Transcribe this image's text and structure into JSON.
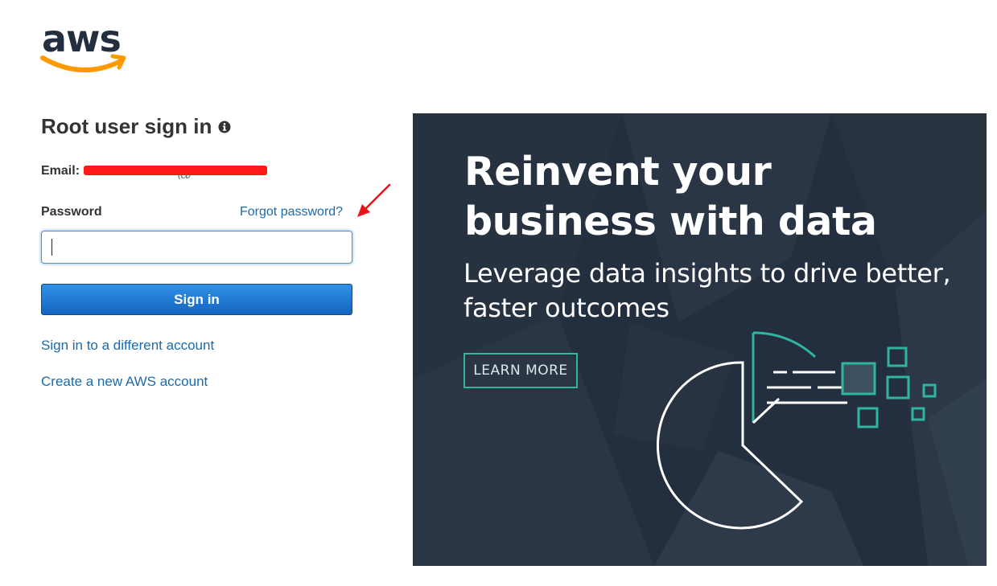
{
  "brand": {
    "logo_text": "aws",
    "logo_colors": {
      "text": "#232f3e",
      "smile": "#ff9900"
    }
  },
  "signin": {
    "title": "Root user sign in",
    "info_icon": "info-circle-icon",
    "email_label": "Email:",
    "email_visible_fragment": "@",
    "password_label": "Password",
    "forgot_link": "Forgot password?",
    "password_value": "",
    "submit_label": "Sign in",
    "links": {
      "different_account": "Sign in to a different account",
      "create_account": "Create a new AWS account"
    },
    "colors": {
      "link": "#1c6aa9",
      "button": "#1e78d6",
      "annotation": "#e8141a"
    }
  },
  "banner": {
    "headline": "Reinvent your business with data",
    "subheadline": "Leverage data insights to drive better, faster outcomes",
    "cta_label": "LEARN MORE",
    "illustration_icon": "pie-chart-data-icon",
    "colors": {
      "background": "#232f3e",
      "accent": "#2fb5a0"
    }
  }
}
